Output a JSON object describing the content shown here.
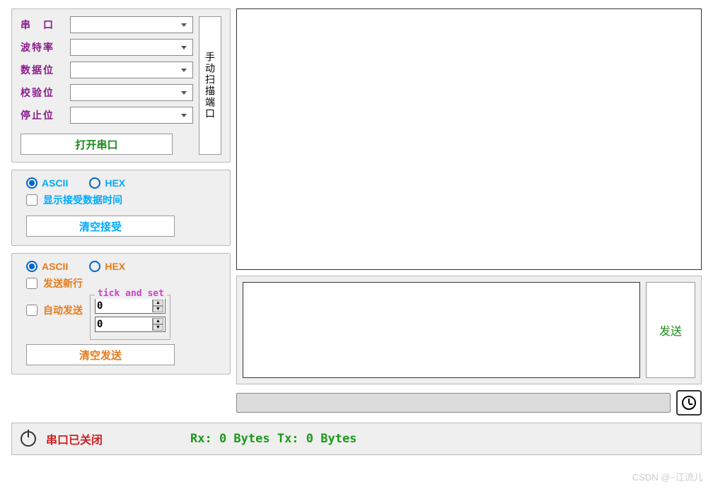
{
  "port": {
    "labels": {
      "port": "串　口",
      "baud": "波特率",
      "data": "数据位",
      "parity": "校验位",
      "stop": "停止位"
    },
    "values": {
      "port": "",
      "baud": "",
      "data": "",
      "parity": "",
      "stop": ""
    },
    "scan_btn": "手动扫描端口",
    "open_btn": "打开串口"
  },
  "rx": {
    "ascii": "ASCII",
    "hex": "HEX",
    "show_time": "显示接受数据时间",
    "clear": "清空接受"
  },
  "tx": {
    "ascii": "ASCII",
    "hex": "HEX",
    "newline": "发送新行",
    "auto": "自动发送",
    "tick_legend": "tick and set",
    "tick1": "0",
    "tick2": "0",
    "clear": "清空发送",
    "send": "发送"
  },
  "status": {
    "closed": "串口已关闭",
    "bytes": "Rx: 0 Bytes  Tx: 0 Bytes"
  },
  "watermark": "CSDN @~江流儿"
}
